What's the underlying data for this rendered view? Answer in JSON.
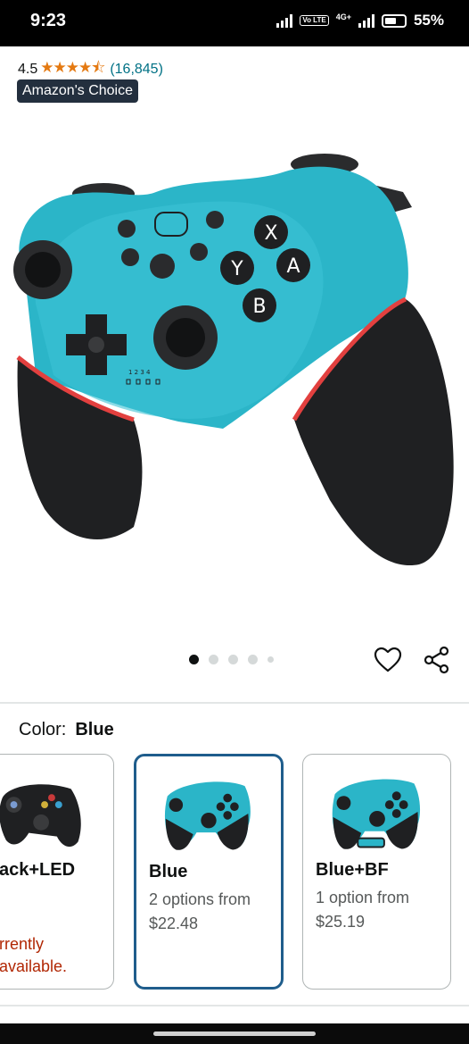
{
  "status_bar": {
    "time": "9:23",
    "volte": "Vo LTE",
    "network": "4G+",
    "battery": "55%"
  },
  "product": {
    "rating_value": "4.5",
    "stars": "★★★★⯪",
    "rating_count": "(16,845)",
    "badge": "Amazon's Choice",
    "image_count": 5,
    "active_image": 1
  },
  "color": {
    "label": "Color:",
    "selected": "Blue"
  },
  "variants": [
    {
      "name": "ack+LED",
      "unavailable_line1": "rrently",
      "unavailable_line2": "available."
    },
    {
      "name": "Blue",
      "options": "2 options from",
      "price": "$22.48",
      "selected": true
    },
    {
      "name": "Blue+BF",
      "options": "1 option from",
      "price": "$25.19"
    }
  ],
  "icons": {
    "favorite": "heart-icon",
    "share": "share-icon"
  },
  "colors": {
    "accent_teal": "#2bb5c8",
    "grip_black": "#1f2022",
    "trim_red": "#e2403f",
    "badge_bg": "#232f3e",
    "star": "#e47911",
    "link": "#007185",
    "selected_border": "#1f5d8c",
    "unavailable": "#b12704"
  }
}
